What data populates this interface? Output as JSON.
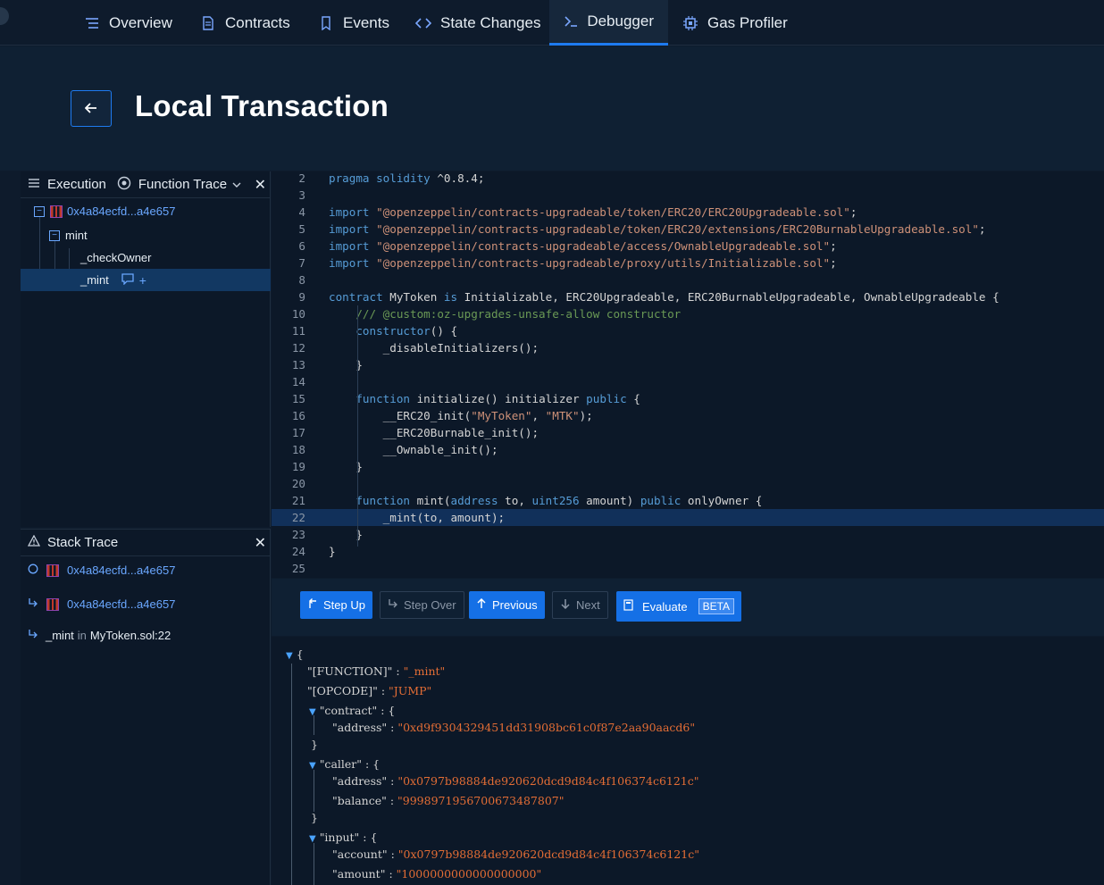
{
  "nav": {
    "tabs": [
      {
        "label": "Overview",
        "icon": "list-icon"
      },
      {
        "label": "Contracts",
        "icon": "document-icon"
      },
      {
        "label": "Events",
        "icon": "bookmark-icon"
      },
      {
        "label": "State Changes",
        "icon": "code-icon"
      },
      {
        "label": "Debugger",
        "icon": "terminal-icon"
      },
      {
        "label": "Gas Profiler",
        "icon": "chip-icon"
      }
    ],
    "active": "Debugger"
  },
  "header": {
    "title": "Local Transaction"
  },
  "execution": {
    "tab_label": "Execution",
    "mode_label": "Function Trace",
    "tree": [
      {
        "label": "0x4a84ecfd...a4e657",
        "type": "address"
      },
      {
        "label": "mint",
        "type": "function"
      },
      {
        "label": "_checkOwner",
        "type": "function"
      },
      {
        "label": "_mint",
        "type": "function",
        "selected": true
      }
    ],
    "add_symbol": "+"
  },
  "stack": {
    "title": "Stack Trace",
    "rows": [
      {
        "label": "0x4a84ecfd...a4e657"
      },
      {
        "label": "0x4a84ecfd...a4e657"
      },
      {
        "fn": "_mint",
        "in": "in",
        "file": "MyToken.sol:22"
      }
    ]
  },
  "code": {
    "highlight_line": "22",
    "lines": [
      {
        "n": "2",
        "text": "pragma solidity ^0.8.4;"
      },
      {
        "n": "3",
        "text": ""
      },
      {
        "n": "4",
        "text": "import \"@openzeppelin/contracts-upgradeable/token/ERC20/ERC20Upgradeable.sol\";"
      },
      {
        "n": "5",
        "text": "import \"@openzeppelin/contracts-upgradeable/token/ERC20/extensions/ERC20BurnableUpgradeable.sol\";"
      },
      {
        "n": "6",
        "text": "import \"@openzeppelin/contracts-upgradeable/access/OwnableUpgradeable.sol\";"
      },
      {
        "n": "7",
        "text": "import \"@openzeppelin/contracts-upgradeable/proxy/utils/Initializable.sol\";"
      },
      {
        "n": "8",
        "text": ""
      },
      {
        "n": "9",
        "text": "contract MyToken is Initializable, ERC20Upgradeable, ERC20BurnableUpgradeable, OwnableUpgradeable {"
      },
      {
        "n": "10",
        "text": "    /// @custom:oz-upgrades-unsafe-allow constructor"
      },
      {
        "n": "11",
        "text": "    constructor() {"
      },
      {
        "n": "12",
        "text": "        _disableInitializers();"
      },
      {
        "n": "13",
        "text": "    }"
      },
      {
        "n": "14",
        "text": ""
      },
      {
        "n": "15",
        "text": "    function initialize() initializer public {"
      },
      {
        "n": "16",
        "text": "        __ERC20_init(\"MyToken\", \"MTK\");"
      },
      {
        "n": "17",
        "text": "        __ERC20Burnable_init();"
      },
      {
        "n": "18",
        "text": "        __Ownable_init();"
      },
      {
        "n": "19",
        "text": "    }"
      },
      {
        "n": "20",
        "text": ""
      },
      {
        "n": "21",
        "text": "    function mint(address to, uint256 amount) public onlyOwner {"
      },
      {
        "n": "22",
        "text": "        _mint(to, amount);"
      },
      {
        "n": "23",
        "text": "    }"
      },
      {
        "n": "24",
        "text": "}"
      },
      {
        "n": "25",
        "text": ""
      }
    ]
  },
  "controls": {
    "step_up": "Step Up",
    "step_over": "Step Over",
    "previous": "Previous",
    "next": "Next",
    "evaluate": "Evaluate",
    "beta": "BETA"
  },
  "json_view": {
    "open_brace": "{",
    "function_key": "\"[FUNCTION]\"",
    "function_val": "\"_mint\"",
    "opcode_key": "\"[OPCODE]\"",
    "opcode_val": "\"JUMP\"",
    "contract_key": "\"contract\"",
    "contract_address_key": "\"address\"",
    "contract_address_val": "\"0xd9f9304329451dd31908bc61c0f87e2aa90aacd6\"",
    "caller_key": "\"caller\"",
    "caller_address_key": "\"address\"",
    "caller_address_val": "\"0x0797b98884de920620dcd9d84c4f106374c6121c\"",
    "caller_balance_key": "\"balance\"",
    "caller_balance_val": "\"9998971956700673487807\"",
    "input_key": "\"input\"",
    "input_account_key": "\"account\"",
    "input_account_val": "\"0x0797b98884de920620dcd9d84c4f106374c6121c\"",
    "input_amount_key": "\"amount\"",
    "input_amount_val": "\"1000000000000000000\""
  }
}
